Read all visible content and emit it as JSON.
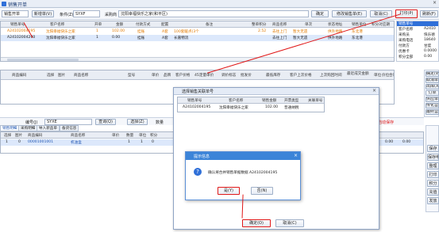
{
  "window": {
    "title": "销售开单",
    "close_label": "×"
  },
  "toolbar": {
    "type_select": "销售开单",
    "new_button": "新增单(V)",
    "condition_label": "条件(Z)",
    "condition_value": "SYXF",
    "customer_label": "采购商",
    "customer_value": "沈阳幸福快乐之家(和平区)",
    "confirm_button": "确定",
    "modify_button": "修改销售单(E)",
    "cancel_button": "取消(C)",
    "print_button": "打印(P)",
    "refresh_button": "刷新(F)"
  },
  "orders": {
    "headers": [
      "销售单号",
      "客户名称",
      "开单",
      "金额",
      "付款方式",
      "配置",
      "备注",
      "整单积分",
      "商品名称",
      "单次",
      "状态地址",
      "销售单位",
      "积分对应期"
    ],
    "rows": [
      [
        "A24102004195",
        "沈阳幸福快乐之家",
        "1",
        "102.00",
        "挂账",
        "A套",
        "100套暖点(3个",
        "2.52",
        "去往上门",
        "暂大无遗",
        "供外地路",
        "东北港"
      ],
      [
        "A24102004200",
        "沈阳幸福快乐之家",
        "1",
        "0.00",
        "挂账",
        "A套",
        "长嘉物流",
        "",
        "去往上门",
        "暂大无遗",
        "供外地路",
        "东北港"
      ]
    ]
  },
  "right_panel": {
    "title": "销售单号",
    "items": [
      "客户名称",
      "采购员",
      "采购电话",
      "付款方",
      "优惠卡",
      "积分全部"
    ],
    "values": [
      "A2410",
      "快乐德",
      "18640",
      "甘度",
      "0.0000",
      "0.00"
    ]
  },
  "right_panel2": {
    "items": [
      "确定(W)",
      "取消单据",
      "出库(X)",
      "订单",
      "供应单(U)",
      "传化营(T)",
      "最终营销款"
    ]
  },
  "detail": {
    "headers": [
      "商品编码",
      "选择",
      "图片",
      "商品名称",
      "型号",
      "单价",
      "品牌",
      "客户价格",
      "45定量单价",
      "调价标志",
      "批发价",
      "最低库存",
      "客户上次价格",
      "上次购回时间",
      "最近成交金额",
      "单位",
      "价位",
      "合计"
    ]
  },
  "detail_bar": {
    "num_label": "编号(J)",
    "num_value": "SYXE",
    "search_label": "查询(Q)",
    "select_label": "选择(Z)",
    "qty_label": "数量",
    "autosave_label": "自动保存"
  },
  "bottom": {
    "tabs": [
      "销售明细",
      "采购明细",
      "导入新品单",
      "备货信息"
    ],
    "headers": [
      "选择",
      "图片",
      "商品编码",
      "商品名称",
      "单价",
      "数量",
      "单位",
      "积分"
    ],
    "row": [
      "1",
      "0",
      "00001001001",
      "机油盒",
      "",
      "1",
      "1",
      "0"
    ],
    "right_values": [
      "0.00",
      "0.00",
      "0.00"
    ]
  },
  "bottom_right": {
    "items": [
      "保存",
      "保存申请",
      "整理",
      "打印",
      "积分",
      "充值",
      "发放"
    ]
  },
  "select_dialog": {
    "title": "选择销售关联单号",
    "headers": [
      "销售单号",
      "客户名称",
      "销售金额",
      "开票类型",
      "关联单号"
    ],
    "row": [
      "A24102004195",
      "沈阳幸福快乐之家",
      "102.00",
      "普通纳税",
      ""
    ],
    "ok_button": "确定(O)",
    "cancel_button": "取消(C)"
  },
  "message": {
    "title": "提示信息",
    "text": "确认将合并销售单据数据  A24102004195",
    "yes_button": "是(Y)",
    "no_button": "否(N)"
  },
  "colors": {
    "accent": "#3c84d8",
    "highlight": "#e07a00",
    "annotation": "#e01818"
  }
}
